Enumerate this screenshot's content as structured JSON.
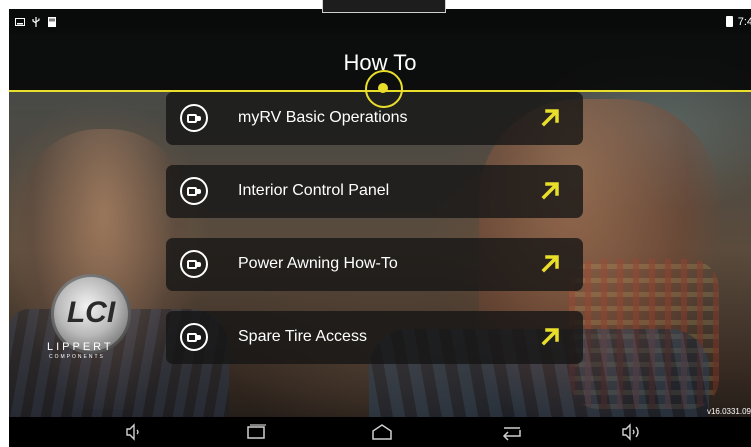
{
  "status_bar": {
    "clock": "7:4",
    "left_icons": [
      "screenshot-icon",
      "usb-icon",
      "storage-icon"
    ],
    "battery_icon": "battery-icon"
  },
  "header": {
    "title": "How To"
  },
  "menu": {
    "items": [
      {
        "label": "myRV Basic Operations",
        "icon": "video-camera-icon",
        "arrow": "arrow-up-right-icon"
      },
      {
        "label": "Interior Control Panel",
        "icon": "video-camera-icon",
        "arrow": "arrow-up-right-icon"
      },
      {
        "label": "Power Awning How-To",
        "icon": "video-camera-icon",
        "arrow": "arrow-up-right-icon"
      },
      {
        "label": "Spare Tire Access",
        "icon": "video-camera-icon",
        "arrow": "arrow-up-right-icon"
      }
    ]
  },
  "brand": {
    "name": "LIPPERT",
    "sub": "COMPONENTS",
    "mark": "LCI"
  },
  "version": "v16.0331.09",
  "navigation_bar": [
    "volume-down-icon",
    "recent-apps-icon",
    "home-icon",
    "back-icon",
    "volume-up-icon"
  ],
  "colors": {
    "accent": "#e9df2b",
    "header_bg": "#000000",
    "menu_item_bg": "#141414"
  }
}
